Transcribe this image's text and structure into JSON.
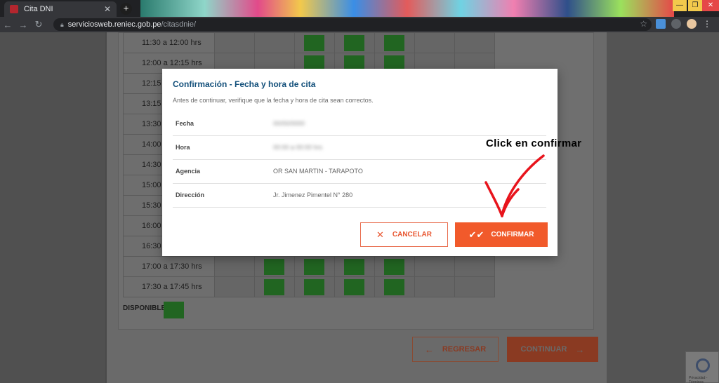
{
  "browser": {
    "tab_title": "Cita DNI",
    "tab_close": "✕",
    "new_tab": "+",
    "url_host": "serviciosweb.reniec.gob.pe",
    "url_path": "/citasdnie/",
    "window_controls": [
      "—",
      "❐",
      "✕"
    ]
  },
  "schedule": {
    "rows": [
      {
        "time": "11:30 a 12:00 hrs",
        "slots": [
          false,
          false,
          true,
          true,
          true,
          false,
          false
        ]
      },
      {
        "time": "12:00 a 12:15 hrs",
        "slots": [
          false,
          false,
          true,
          true,
          true,
          false,
          false
        ]
      },
      {
        "time": "12:15",
        "slots": [
          false,
          false,
          false,
          false,
          false,
          false,
          false
        ]
      },
      {
        "time": "13:15",
        "slots": [
          false,
          false,
          false,
          false,
          false,
          false,
          false
        ]
      },
      {
        "time": "13:30",
        "slots": [
          false,
          false,
          false,
          false,
          false,
          false,
          false
        ]
      },
      {
        "time": "14:00",
        "slots": [
          false,
          false,
          false,
          false,
          false,
          false,
          false
        ]
      },
      {
        "time": "14:30",
        "slots": [
          false,
          false,
          false,
          false,
          false,
          false,
          false
        ]
      },
      {
        "time": "15:00",
        "slots": [
          false,
          false,
          false,
          false,
          false,
          false,
          false
        ]
      },
      {
        "time": "15:30",
        "slots": [
          false,
          false,
          false,
          false,
          false,
          false,
          false
        ]
      },
      {
        "time": "16:00",
        "slots": [
          false,
          false,
          false,
          false,
          false,
          false,
          false
        ]
      },
      {
        "time": "16:30",
        "slots": [
          false,
          false,
          false,
          false,
          false,
          false,
          false
        ]
      },
      {
        "time": "17:00 a 17:30 hrs",
        "slots": [
          false,
          true,
          true,
          true,
          true,
          false,
          false
        ]
      },
      {
        "time": "17:30 a 17:45 hrs",
        "slots": [
          false,
          true,
          true,
          true,
          true,
          false,
          false
        ]
      }
    ]
  },
  "legend": {
    "disponible_label": "DISPONIBLE:"
  },
  "footer": {
    "regresar_label": "REGRESAR",
    "continuar_label": "CONTINUAR"
  },
  "recaptcha": {
    "text": "Privacidad - Términos"
  },
  "modal": {
    "title": "Confirmación - Fecha y hora de cita",
    "subtitle": "Antes de continuar, verifique que la fecha y hora de cita sean correctos.",
    "details": [
      {
        "label": "Fecha",
        "value": "00/00/0000",
        "blurred": true
      },
      {
        "label": "Hora",
        "value": "00:00 a 00:00 hrs",
        "blurred": true
      },
      {
        "label": "Agencia",
        "value": "OR SAN MARTIN - TARAPOTO",
        "blurred": false
      },
      {
        "label": "Dirección",
        "value": "Jr. Jimenez Pimentel N° 280",
        "blurred": false
      }
    ],
    "cancel_label": "CANCELAR",
    "confirm_label": "CONFIRMAR"
  },
  "annotation": {
    "text": "Click en confirmar",
    "color": "#e8141c"
  },
  "colors": {
    "accent": "#f15a2b",
    "title": "#124f7a",
    "available": "#216521"
  }
}
